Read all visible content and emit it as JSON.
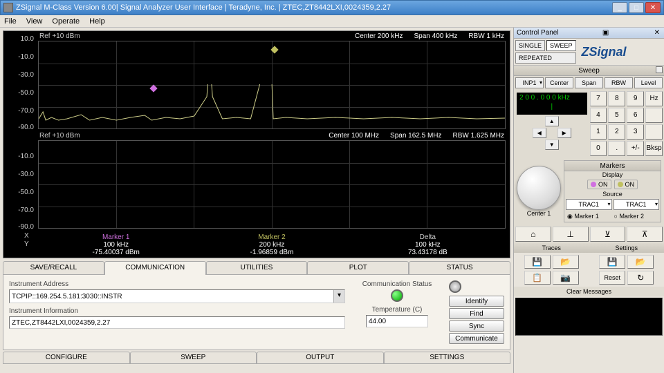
{
  "window": {
    "title": "ZSignal M-Class Version 6.00| Signal Analyzer User Interface | Teradyne, Inc. | ZTEC,ZT8442LXI,0024359,2.27"
  },
  "menu": [
    "File",
    "View",
    "Operate",
    "Help"
  ],
  "plot": {
    "ref1": "Ref +10 dBm",
    "hdr1": {
      "center": "Center   200 kHz",
      "span": "Span   400 kHz",
      "rbw": "RBW   1 kHz"
    },
    "ref2": "Ref +10 dBm",
    "hdr2": {
      "center": "Center   100 MHz",
      "span": "Span  162.5 MHz",
      "rbw": "RBW  1.625 MHz"
    },
    "ylabels1": [
      "10.0",
      "-10.0",
      "-30.0",
      "-50.0",
      "-70.0",
      "-90.0"
    ],
    "ylabels2": [
      "-10.0",
      "-30.0",
      "-50.0",
      "-70.0",
      "-90.0"
    ],
    "markers": {
      "m1": {
        "name": "Marker 1",
        "x": "100 kHz",
        "y": "-75.40037 dBm"
      },
      "m2": {
        "name": "Marker 2",
        "x": "200 kHz",
        "y": "-1.96859 dBm"
      },
      "delta": {
        "name": "Delta",
        "x": "100 kHz",
        "y": "73.43178 dB"
      }
    },
    "xaxis": "X",
    "yaxis": "Y"
  },
  "tabs": [
    "SAVE/RECALL",
    "COMMUNICATION",
    "UTILITIES",
    "PLOT",
    "STATUS"
  ],
  "comm": {
    "addr_lbl": "Instrument Address",
    "addr_val": "TCPIP::169.254.5.181:3030::INSTR",
    "info_lbl": "Instrument Information",
    "info_val": "ZTEC,ZT8442LXI,0024359,2.27",
    "status_lbl": "Communication Status",
    "temp_lbl": "Temperature (C)",
    "temp_val": "44.00",
    "btns": [
      "Identify",
      "Find",
      "Sync",
      "Communicate"
    ]
  },
  "btabs": [
    "CONFIGURE",
    "SWEEP",
    "OUTPUT",
    "SETTINGS"
  ],
  "cp": {
    "title": "Control Panel",
    "single": "SINGLE",
    "sweep": "SWEEP",
    "repeated": "REPEATED",
    "logo": "ZSignal",
    "sweep_sec": "Sweep",
    "sweep_btns": [
      "INP1",
      "Center",
      "Span",
      "RBW",
      "Level"
    ],
    "readout": "2  0  0 .  0  0  0 kHz",
    "keypad": [
      "7",
      "8",
      "9",
      "Hz",
      "4",
      "5",
      "6",
      "",
      "1",
      "2",
      "3",
      "",
      "0",
      ".",
      "+/-",
      "Bksp"
    ],
    "center_lbl": "Center 1",
    "markers_h": "Markers",
    "display_lbl": "Display",
    "on": "ON",
    "source_lbl": "Source",
    "trac": "TRAC1",
    "marker_r": [
      "Marker 1",
      "Marker 2"
    ],
    "traces_h": "Traces",
    "settings_h": "Settings",
    "reset": "Reset",
    "clear": "Clear Messages"
  }
}
